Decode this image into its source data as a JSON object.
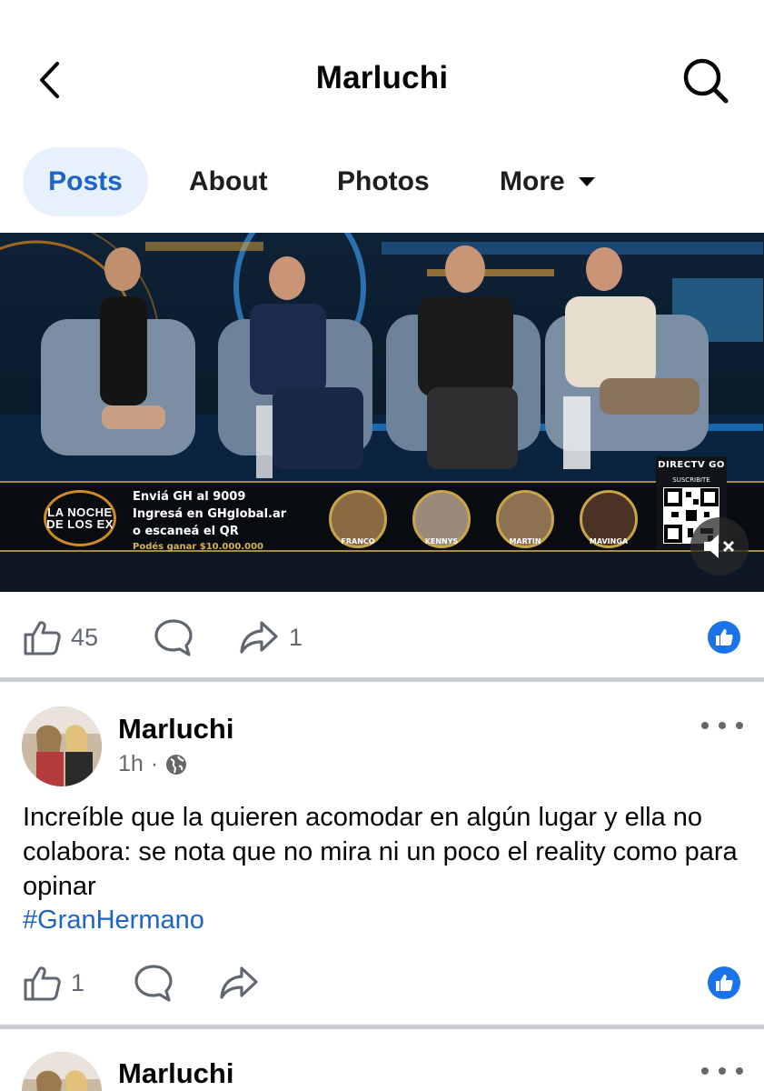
{
  "header": {
    "title": "Marluchi",
    "back_icon": "chevron-left-icon",
    "search_icon": "search-icon"
  },
  "tabs": [
    {
      "label": "Posts",
      "active": true
    },
    {
      "label": "About",
      "active": false
    },
    {
      "label": "Photos",
      "active": false
    },
    {
      "label": "More",
      "active": false
    }
  ],
  "video": {
    "show_logo": [
      "LA NOCHE",
      "DE LOS EX"
    ],
    "promo_lines": [
      "Enviá GH al 9009",
      "Ingresá en GHglobal.ar",
      "o escaneá el QR"
    ],
    "prize": "Podés ganar $10.000.000",
    "contestants": [
      "FRANCO",
      "KENNYS",
      "MARTIN",
      "MAVINGA"
    ],
    "qr_brand": "DIRECTV GO",
    "qr_sub": "SUSCRIBITE",
    "muted": true
  },
  "post1_actions": {
    "likes": "45",
    "shares": "1"
  },
  "post2": {
    "author": "Marluchi",
    "time": "1h",
    "audience_icon": "globe-icon",
    "text": "Increíble que la quieren acomodar en algún lugar y ella no colabora: se nota que no mira ni un poco el reality como para opinar",
    "hashtag": "#GranHermano",
    "likes": "1"
  },
  "post3": {
    "author": "Marluchi"
  },
  "colors": {
    "accent": "#1d64c9",
    "tab_active_bg": "#e7f0fd",
    "like_badge": "#1a73e8",
    "meta_text": "#65676b"
  }
}
